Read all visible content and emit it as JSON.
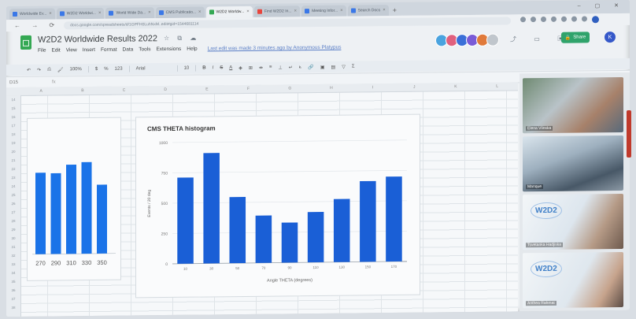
{
  "tabs": [
    {
      "label": "Worldwide Ev..."
    },
    {
      "label": "W2D2 Worldwi..."
    },
    {
      "label": "World Wide Da..."
    },
    {
      "label": "CMS Publicatio..."
    },
    {
      "label": "W2D2 Worldw..."
    },
    {
      "label": "Find W2D2 In..."
    },
    {
      "label": "Meeting Infor..."
    },
    {
      "label": "Search Docs"
    }
  ],
  "address": {
    "url": "docs.google.com/spreadsheets/d/1GPFH0LuhNxM..edit#gid=1544681114"
  },
  "doc": {
    "title": "W2D2 Worldwide Results 2022",
    "menu": [
      "File",
      "Edit",
      "View",
      "Insert",
      "Format",
      "Data",
      "Tools",
      "Extensions",
      "Help"
    ],
    "last_edit": "Last edit was made 3 minutes ago by Anonymous Platypus",
    "share_label": "Share",
    "user_initial": "K"
  },
  "toolbar": {
    "zoom": "100%",
    "currency": "$",
    "percent": "%",
    "format": "123",
    "font": "Arial",
    "size": "10"
  },
  "formula": {
    "cell": "D15",
    "fx": "fx"
  },
  "columns": [
    "A",
    "B",
    "C",
    "D",
    "E",
    "F",
    "G",
    "H",
    "I",
    "J",
    "K",
    "L"
  ],
  "rows": [
    "14",
    "15",
    "16",
    "17",
    "18",
    "19",
    "20",
    "21",
    "22",
    "23",
    "24",
    "25",
    "26",
    "27",
    "28",
    "29",
    "30",
    "31",
    "32",
    "33",
    "34",
    "35",
    "36",
    "37",
    "38"
  ],
  "chart_data": [
    {
      "type": "bar",
      "title": "",
      "categories": [
        "270",
        "290",
        "310",
        "330",
        "350"
      ],
      "values": [
        680,
        675,
        745,
        765,
        575
      ],
      "ylim": [
        0,
        1000
      ],
      "color": "#1a73e8"
    },
    {
      "type": "bar",
      "title": "CMS THETA histogram",
      "xlabel": "Angle THETA (degrees)",
      "ylabel": "Events / 20 deg",
      "categories": [
        "10",
        "30",
        "50",
        "70",
        "90",
        "110",
        "130",
        "150",
        "170"
      ],
      "values": [
        710,
        910,
        545,
        390,
        330,
        415,
        520,
        665,
        700
      ],
      "yticks": [
        "0",
        "250",
        "500",
        "750",
        "1000"
      ],
      "ylim": [
        0,
        1000
      ],
      "color": "#1a5fd6"
    }
  ],
  "participants": [
    {
      "name": "Elena Vlinska"
    },
    {
      "name": "Manque"
    },
    {
      "name": "Tsvetanka Hadjiska"
    },
    {
      "name": "Anthea Rahmat"
    }
  ],
  "logo_text": "W2D2"
}
